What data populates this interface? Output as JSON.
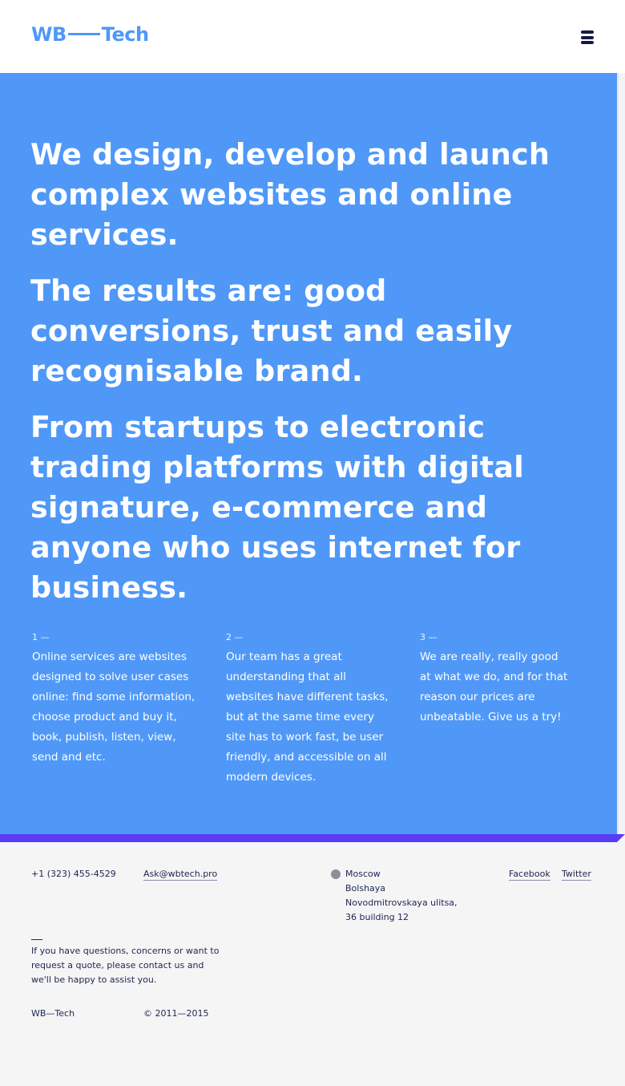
{
  "header": {
    "logo_left": "WB",
    "logo_right": "Tech",
    "menu_icon": "hamburger-menu-icon"
  },
  "hero": {
    "statements": [
      "We design, develop and launch complex websites and online services.",
      "The results are: good conversions, trust and easily recognisable brand.",
      "From startups to electronic trading platforms with digital signature, e-commerce and anyone who uses internet for business."
    ],
    "columns": [
      {
        "number": "1 —",
        "text": "Online services are websites designed to solve user cases online: find some information, choose product and buy it, book, publish, listen, view, send and etc."
      },
      {
        "number": "2 —",
        "text": "Our team has a great understanding that all websites have different tasks, but at the same time every site has to work fast, be user friendly, and accessible on all modern devices."
      },
      {
        "number": "3 —",
        "text": "We are really, really good at what we do, and for that reason our prices are unbeatable. Give us a try!"
      }
    ]
  },
  "footer": {
    "phone": "+1 (323) 455-4529",
    "email": "Ask@wbtech.pro",
    "address_lines": [
      "Moscow",
      "Bolshaya",
      "Novodmitrovskaya ulitsa,",
      "36 building 12"
    ],
    "address_icon": "map-pin-icon",
    "social": [
      "Facebook",
      "Twitter"
    ],
    "note": "If you have questions, concerns or want to request a quote, please contact us and we'll be happy to assist you.",
    "brand": "WB—Tech",
    "copyright": "© 2011—2015"
  },
  "colors": {
    "brand_blue": "#4f98f8",
    "accent_violet": "#5b3cf5",
    "dark_navy": "#141a46",
    "footer_bg": "#f5f5f6"
  }
}
